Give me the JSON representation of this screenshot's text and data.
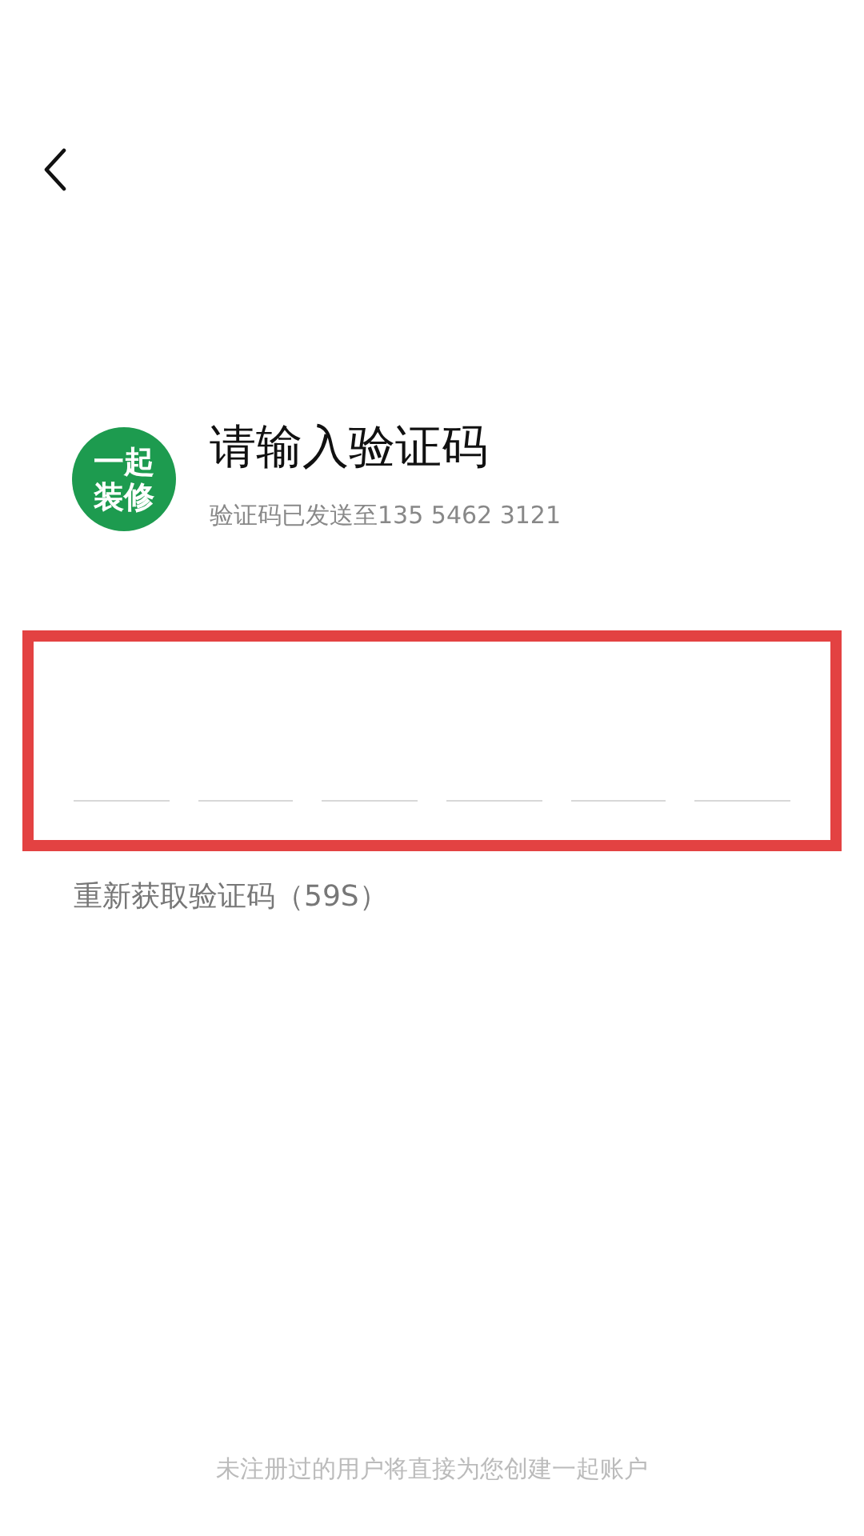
{
  "logo": {
    "lines": [
      "一起",
      "装修"
    ]
  },
  "title": "请输入验证码",
  "subtitle": "验证码已发送至135 5462 3121",
  "code_input": {
    "highlighted": true,
    "slots": [
      {
        "focused": false
      },
      {
        "focused": false
      },
      {
        "focused": false
      },
      {
        "focused": false
      },
      {
        "focused": false
      },
      {
        "focused": false
      }
    ]
  },
  "resend": "重新获取验证码（59S）",
  "footer_note": "未注册过的用户将直接为您创建一起账户"
}
